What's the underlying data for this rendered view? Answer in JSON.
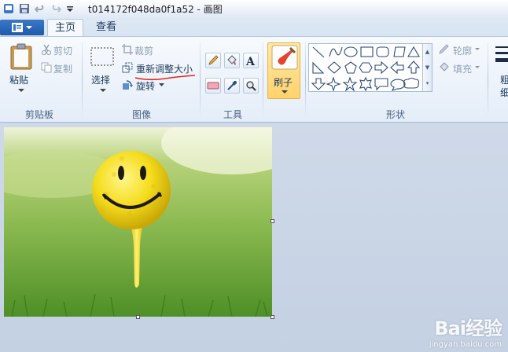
{
  "window": {
    "title": "t014172f048da0f1a52 - 画图"
  },
  "tabs": [
    {
      "label": "主页",
      "active": true
    },
    {
      "label": "查看",
      "active": false
    }
  ],
  "clipboard": {
    "paste": "粘贴",
    "cut": "剪切",
    "copy": "复制",
    "group": "剪贴板"
  },
  "image": {
    "select": "选择",
    "crop": "裁剪",
    "resize": "重新调整大小",
    "rotate": "旋转",
    "group": "图像"
  },
  "tools": {
    "group": "工具"
  },
  "brush": {
    "label": "刷子"
  },
  "shapes": {
    "group": "形状",
    "outline": "轮廓",
    "fill": "填充"
  },
  "size": {
    "label_top": "粗",
    "label_bottom": "细"
  },
  "watermark": {
    "logo": "Bai经验",
    "url": "jingyan.baidu.com"
  },
  "colors": {
    "accent": "#1e5aa8",
    "brush_highlight": "#ffd36b",
    "annotation": "#e0261b"
  }
}
